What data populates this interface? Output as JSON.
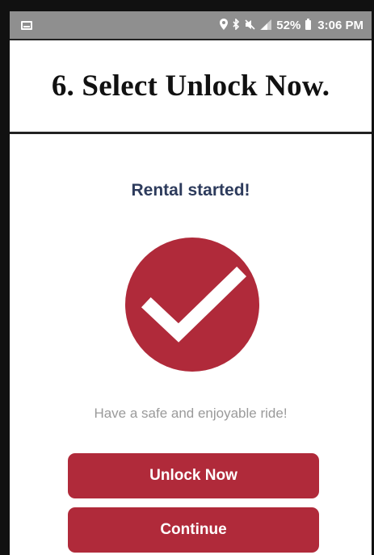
{
  "status_bar": {
    "battery_percent": "52%",
    "time": "3:06 PM",
    "icons": [
      "location-pin-icon",
      "bluetooth-icon",
      "mute-icon",
      "signal-icon",
      "battery-icon"
    ]
  },
  "instruction": {
    "text": "6. Select Unlock Now."
  },
  "screen": {
    "title": "Rental started!",
    "message": "Have a safe and enjoyable ride!",
    "unlock_label": "Unlock Now",
    "continue_label": "Continue"
  },
  "colors": {
    "accent": "#b02a3a",
    "title_text": "#2d3b5c",
    "muted_text": "#9a9a9a",
    "status_bar": "#8f8f8f"
  }
}
